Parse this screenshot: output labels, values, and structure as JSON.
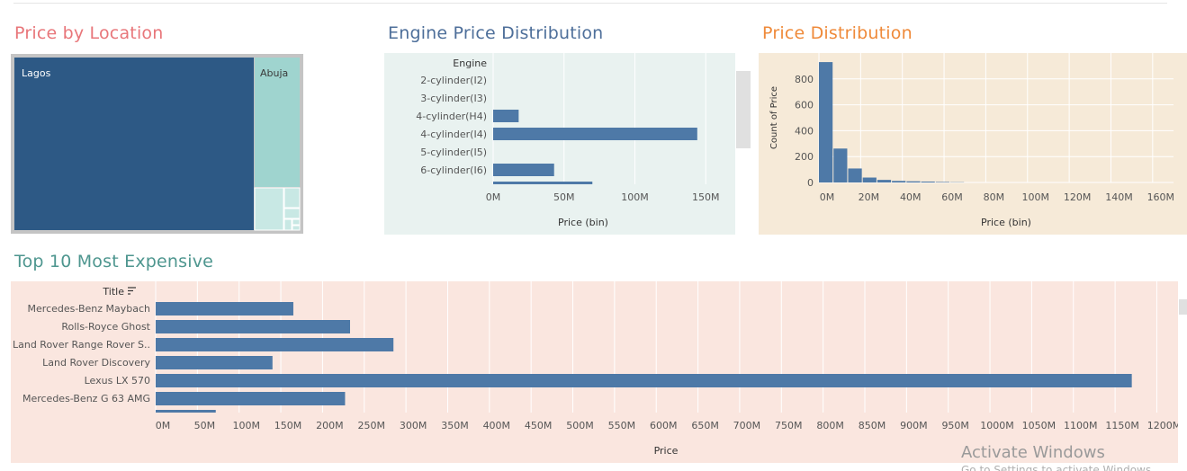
{
  "colors": {
    "bar": "#4e79a7",
    "treemap_dark": "#2d5985",
    "treemap_light": "#9fd4cf",
    "engine_bg": "#e9f2f0",
    "price_bg": "#f6ead8",
    "top10_bg": "#fae6df"
  },
  "titles": {
    "location": "Price by Location",
    "engine": "Engine Price Distribution",
    "price": "Price Distribution",
    "top10": "Top 10 Most Expensive"
  },
  "title_colors": {
    "location": "#e8767a",
    "engine": "#4e6f9a",
    "price": "#ef8a3a",
    "top10": "#4e968f"
  },
  "treemap": {
    "labels": [
      "Lagos",
      "Abuja"
    ]
  },
  "watermark": {
    "line1": "Activate Windows",
    "line2": "Go to Settings to activate Windows."
  },
  "chart_data": [
    {
      "type": "bar",
      "orientation": "horizontal",
      "title": "Engine Price Distribution",
      "row_header": "Engine",
      "xlabel": "Price (bin)",
      "categories": [
        "2-cylinder(I2)",
        "3-cylinder(I3)",
        "4-cylinder(H4)",
        "4-cylinder(I4)",
        "5-cylinder(I5)",
        "6-cylinder(I6)"
      ],
      "values": [
        0,
        0,
        18,
        144,
        0,
        43
      ],
      "value_unit": "M",
      "xlim": [
        0,
        160
      ],
      "xticks": [
        "0M",
        "50M",
        "100M",
        "150M"
      ]
    },
    {
      "type": "bar",
      "subtype": "histogram",
      "title": "Price Distribution",
      "xlabel": "Price (bin)",
      "ylabel": "Count of Price",
      "bin_width_m": 7,
      "values": [
        930,
        262,
        108,
        38,
        20,
        12,
        9,
        7,
        4,
        2
      ],
      "xlim": [
        0,
        170
      ],
      "ylim": [
        0,
        1000
      ],
      "xticks": [
        "0M",
        "20M",
        "40M",
        "60M",
        "80M",
        "100M",
        "120M",
        "140M",
        "160M"
      ],
      "yticks": [
        "0",
        "200",
        "400",
        "600",
        "800"
      ]
    },
    {
      "type": "bar",
      "orientation": "horizontal",
      "title": "Top 10 Most Expensive",
      "row_header": "Title",
      "xlabel": "Price",
      "categories": [
        "Mercedes-Benz Maybach",
        "Rolls-Royce Ghost",
        "Land Rover Range Rover S..",
        "Land Rover Discovery",
        "Lexus LX 570",
        "Mercedes-Benz G 63 AMG"
      ],
      "values": [
        165,
        233,
        285,
        140,
        1170,
        227
      ],
      "value_unit": "M",
      "xlim": [
        0,
        1220
      ],
      "xticks": [
        "0M",
        "50M",
        "100M",
        "150M",
        "200M",
        "250M",
        "300M",
        "350M",
        "400M",
        "450M",
        "500M",
        "550M",
        "600M",
        "650M",
        "700M",
        "750M",
        "800M",
        "850M",
        "900M",
        "950M",
        "1000M",
        "1050M",
        "1100M",
        "1150M",
        "1200M"
      ]
    }
  ]
}
